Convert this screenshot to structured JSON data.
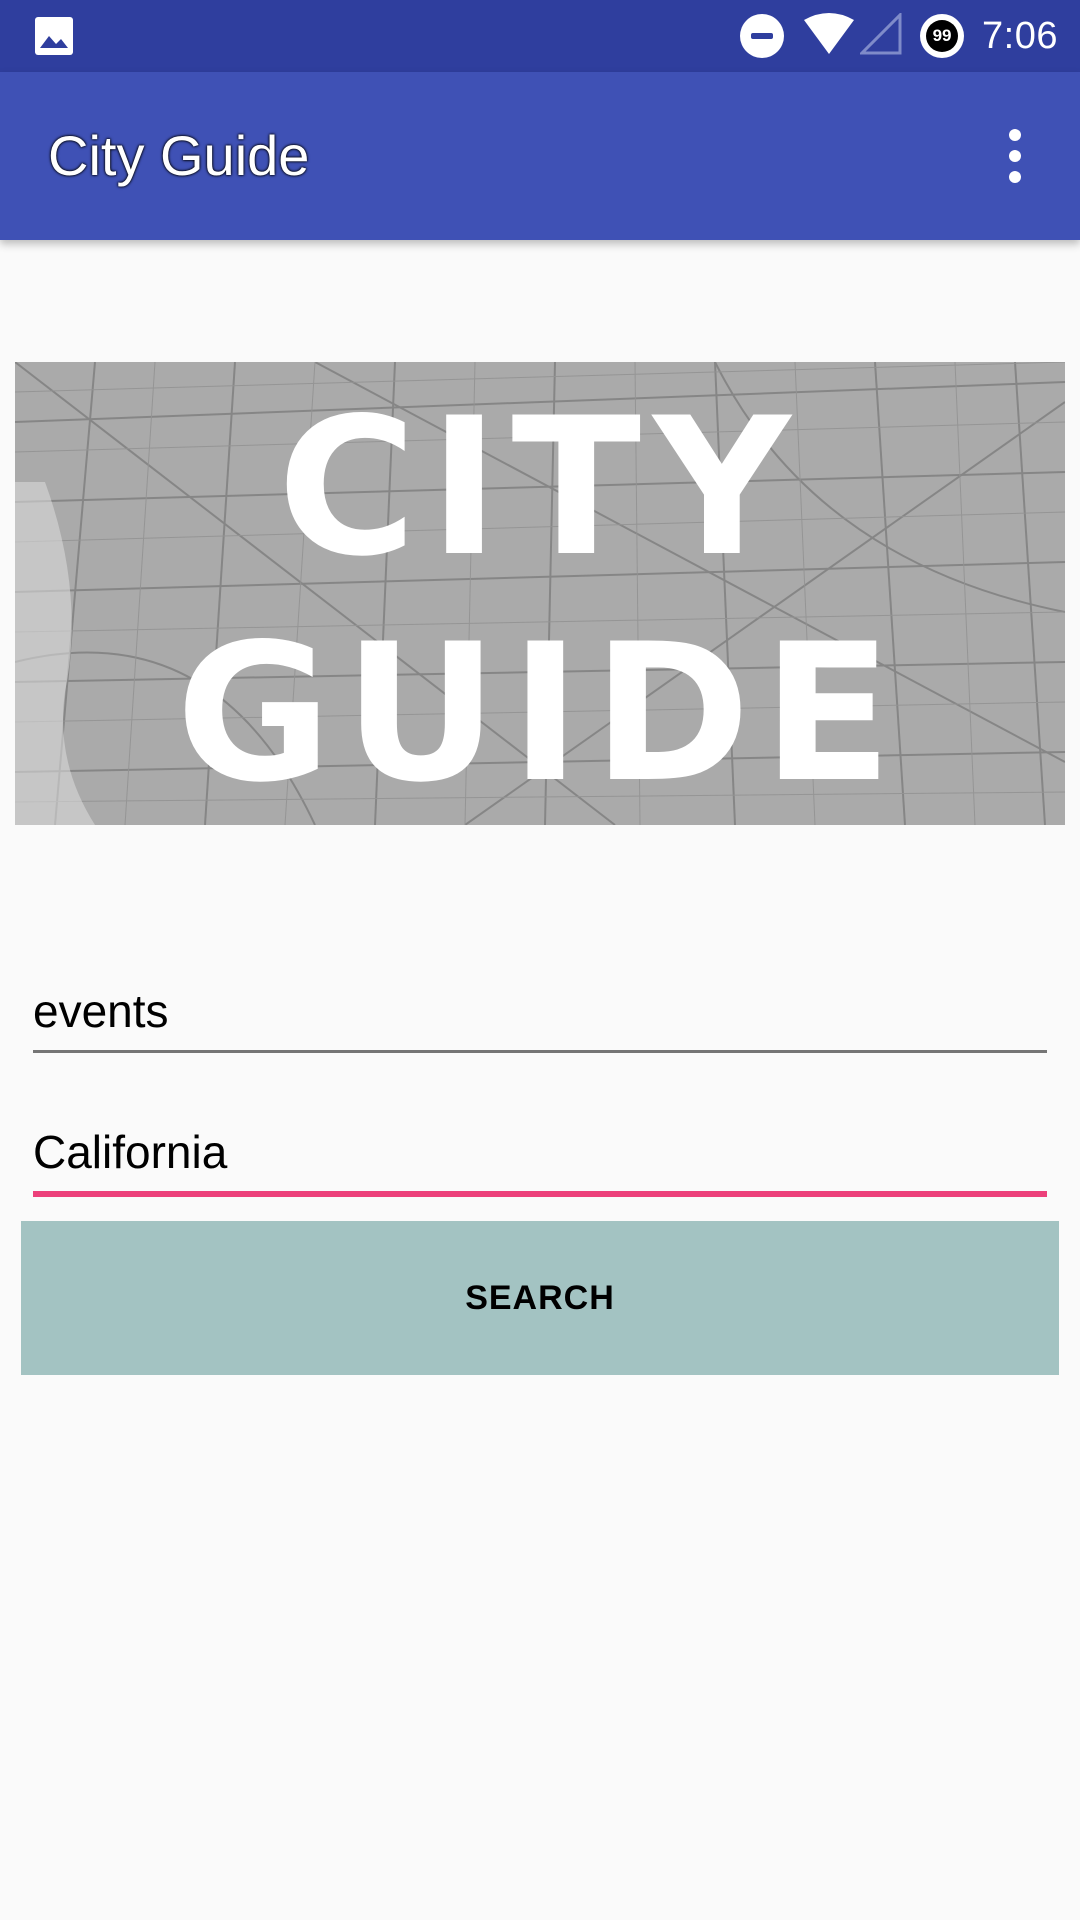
{
  "status_bar": {
    "time": "7:06",
    "battery_saver_badge": "99",
    "icons": [
      "image-icon",
      "do-not-disturb-icon",
      "wifi-icon",
      "cellular-signal-icon",
      "battery-saver-icon"
    ]
  },
  "app_bar": {
    "title": "City Guide",
    "menu_icon": "more-vert-icon"
  },
  "banner": {
    "line1": "CITY",
    "line2": "GUIDE"
  },
  "form": {
    "keyword_value": "events",
    "location_value": "California",
    "search_label": "SEARCH"
  },
  "colors": {
    "status_bar": "#2f3e9e",
    "app_bar": "#3f51b5",
    "accent": "#ec407a",
    "button": "#a3c3c2",
    "background": "#fafafa"
  }
}
